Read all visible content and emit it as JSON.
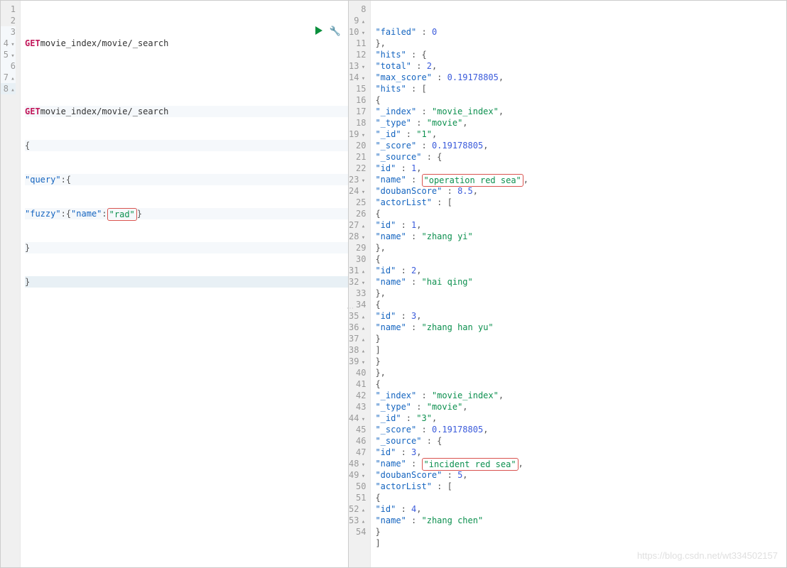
{
  "left": {
    "method": "GET",
    "path": "movie_index/movie/_search",
    "lines": [
      1,
      2,
      3,
      4,
      5,
      6,
      7,
      8
    ],
    "fold4": "▾",
    "fold5": "▾",
    "fold7": "▴",
    "fold8": "▴",
    "query_key": "\"query\"",
    "fuzzy_key": "\"fuzzy\"",
    "name_key": "\"name\"",
    "name_val": "\"rad\"",
    "brace_open": "{",
    "brace_close": "}",
    "colon": ":",
    "brace_close_final": "}"
  },
  "icons": {
    "play": "run-icon",
    "wrench": "wrench-icon"
  },
  "right": {
    "lines": [
      8,
      9,
      10,
      11,
      12,
      13,
      14,
      15,
      16,
      17,
      18,
      19,
      20,
      21,
      22,
      23,
      24,
      25,
      26,
      27,
      28,
      29,
      30,
      31,
      32,
      33,
      34,
      35,
      36,
      37,
      38,
      39,
      40,
      41,
      42,
      43,
      44,
      45,
      46,
      47,
      48,
      49,
      50,
      51,
      52,
      53,
      54
    ],
    "folds": {
      "9": "▴",
      "10": "▾",
      "13": "▾",
      "14": "▾",
      "19": "▾",
      "23": "▾",
      "24": "▾",
      "27": "▴",
      "28": "▾",
      "31": "▴",
      "32": "▾",
      "35": "▴",
      "36": "▴",
      "37": "▴",
      "38": "▴",
      "39": "▾",
      "44": "▾",
      "48": "▾",
      "49": "▾",
      "52": "▴",
      "53": "▴"
    },
    "k_failed": "\"failed\"",
    "v_failed": "0",
    "k_hits": "\"hits\"",
    "k_total": "\"total\"",
    "v_total": "2",
    "k_max_score": "\"max_score\"",
    "v_max_score": "0.19178805",
    "k_index": "\"_index\"",
    "v_index": "\"movie_index\"",
    "k_type": "\"_type\"",
    "v_type": "\"movie\"",
    "k_id": "\"_id\"",
    "v_id1": "\"1\"",
    "v_id3": "\"3\"",
    "k_score": "\"_score\"",
    "v_score": "0.19178805",
    "k_source": "\"_source\"",
    "k_id2": "\"id\"",
    "v_srcid1": "1",
    "v_srcid3": "3",
    "k_name": "\"name\"",
    "v_name1": "\"operation red sea\"",
    "v_name3": "\"incident red sea\"",
    "k_douban": "\"doubanScore\"",
    "v_douban1": "8.5",
    "v_douban3": "5",
    "k_actorList": "\"actorList\"",
    "v_actor1_id": "1",
    "v_actor1_name": "\"zhang yi\"",
    "v_actor2_id": "2",
    "v_actor2_name": "\"hai qing\"",
    "v_actor3_id": "3",
    "v_actor3_name": "\"zhang han yu\"",
    "v_actor4_id": "4",
    "v_actor4_name": "\"zhang chen\"",
    "brace_open": "{",
    "brace_close": "}",
    "bracket_open": "[",
    "bracket_close": "]",
    "colon": " : ",
    "comma": ",",
    "close_brace_comma": "},"
  },
  "watermark": "https://blog.csdn.net/wt334502157"
}
